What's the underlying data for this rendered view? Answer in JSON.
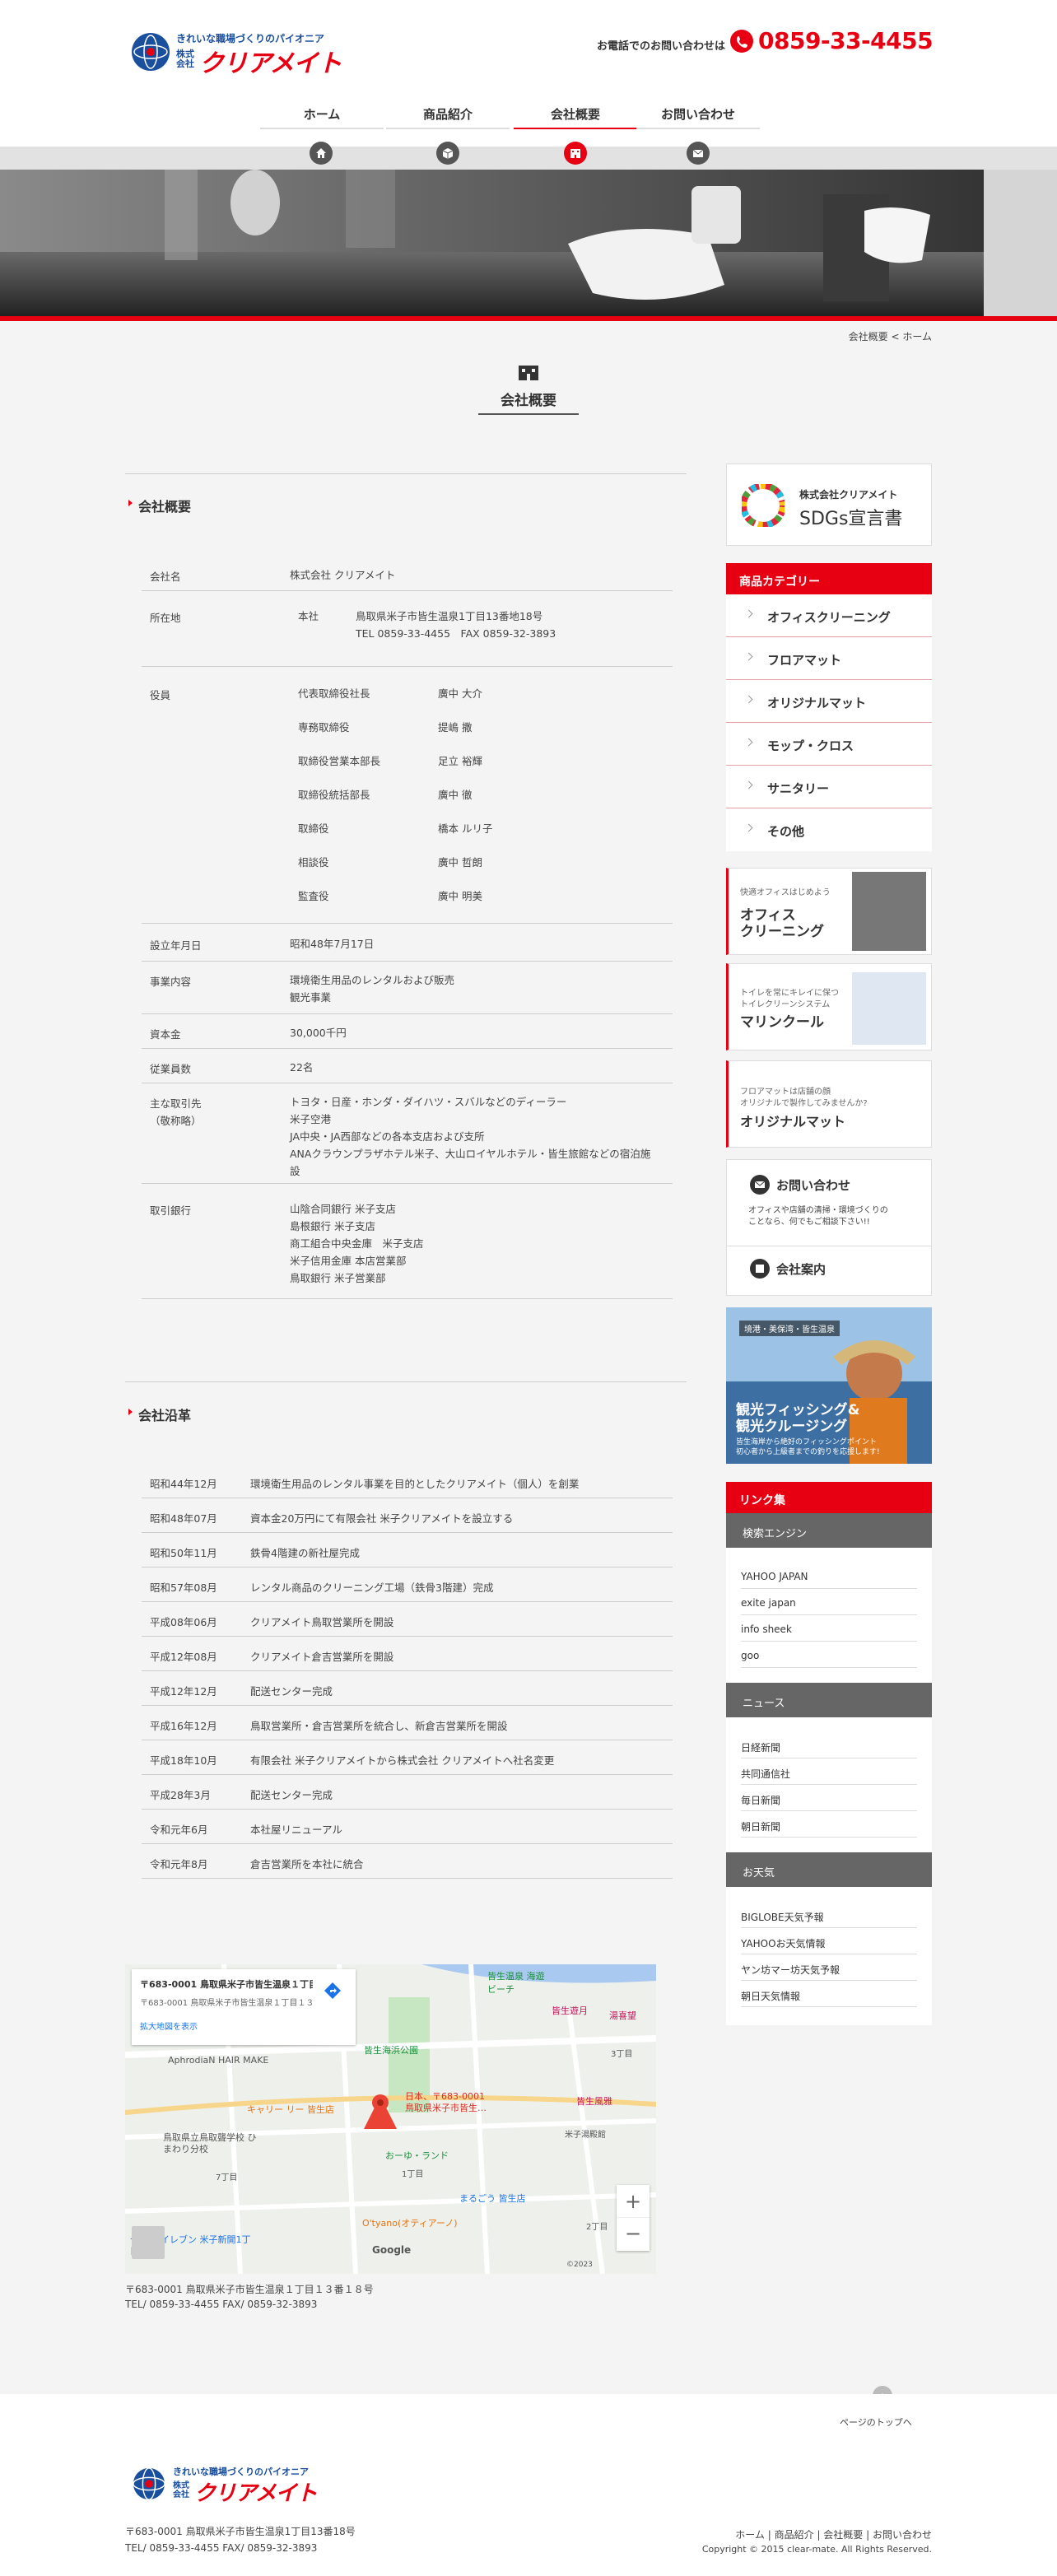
{
  "header": {
    "logo_subtitle": "きれいな職場づくりのパイオニア",
    "logo_corp": "株式会社",
    "logo_name": "クリアメイト",
    "tel_label": "お電話でのお問い合わせは",
    "tel_number": "0859-33-4455"
  },
  "nav": [
    {
      "label": "ホーム",
      "icon": "home-icon"
    },
    {
      "label": "商品紹介",
      "icon": "box-icon"
    },
    {
      "label": "会社概要",
      "icon": "building-icon",
      "active": true
    },
    {
      "label": "お問い合わせ",
      "icon": "mail-icon"
    }
  ],
  "breadcrumb": "会社概要 < ホーム",
  "page_title": "会社概要",
  "overview": {
    "title": "会社概要",
    "name_label": "会社名",
    "name_value": "株式会社 クリアメイト",
    "location_label": "所在地",
    "location_office": "本社",
    "location_address": "鳥取県米子市皆生温泉1丁目13番地18号",
    "location_tel": "TEL 0859-33-4455　FAX 0859-32-3893",
    "officers_label": "役員",
    "officers": [
      {
        "role": "代表取締役社長",
        "name": "廣中 大介"
      },
      {
        "role": "専務取締役",
        "name": "提嶋 撒"
      },
      {
        "role": "取締役営業本部長",
        "name": "足立 裕輝"
      },
      {
        "role": "取締役統括部長",
        "name": "廣中 徹"
      },
      {
        "role": "取締役",
        "name": "橋本 ルリ子"
      },
      {
        "role": "相談役",
        "name": "廣中 哲朗"
      },
      {
        "role": "監査役",
        "name": "廣中 明美"
      }
    ],
    "founded_label": "設立年月日",
    "founded_value": "昭和48年7月17日",
    "business_label": "事業内容",
    "business_value_1": "環境衛生用品のレンタルおよび販売",
    "business_value_2": "観光事業",
    "capital_label": "資本金",
    "capital_value": "30,000千円",
    "employees_label": "従業員数",
    "employees_value": "22名",
    "clients_label_1": "主な取引先",
    "clients_label_2": "（敬称略）",
    "clients_1": "トヨタ・日産・ホンダ・ダイハツ・スバルなどのディーラー",
    "clients_2": "米子空港",
    "clients_3": "JA中央・JA西部などの各本支店および支所",
    "clients_4": "ANAクラウンプラザホテル米子、大山ロイヤルホテル・皆生旅館などの宿泊施",
    "clients_5": "設",
    "banks_label": "取引銀行",
    "banks": [
      "山陰合同銀行 米子支店",
      "島根銀行 米子支店",
      "商工組合中央金庫　米子支店",
      "米子信用金庫 本店営業部",
      "鳥取銀行 米子営業部"
    ]
  },
  "history": {
    "title": "会社沿革",
    "rows": [
      {
        "date": "昭和44年12月",
        "text": "環境衛生用品のレンタル事業を目的としたクリアメイト（個人）を創業"
      },
      {
        "date": "昭和48年07月",
        "text": "資本金20万円にて有限会社 米子クリアメイトを設立する"
      },
      {
        "date": "昭和50年11月",
        "text": "鉄骨4階建の新社屋完成"
      },
      {
        "date": "昭和57年08月",
        "text": "レンタル商品のクリーニング工場（鉄骨3階建）完成"
      },
      {
        "date": "平成08年06月",
        "text": "クリアメイト鳥取営業所を開設"
      },
      {
        "date": "平成12年08月",
        "text": "クリアメイト倉吉営業所を開設"
      },
      {
        "date": "平成12年12月",
        "text": "配送センター完成"
      },
      {
        "date": "平成16年12月",
        "text": "鳥取営業所・倉吉営業所を統合し、新倉吉営業所を開設"
      },
      {
        "date": "平成18年10月",
        "text": "有限会社 米子クリアメイトから株式会社 クリアメイトへ社名変更"
      },
      {
        "date": "平成28年3月",
        "text": "配送センター完成"
      },
      {
        "date": "令和元年6月",
        "text": "本社屋リニューアル"
      },
      {
        "date": "令和元年8月",
        "text": "倉吉営業所を本社に統合"
      }
    ]
  },
  "map": {
    "popup_title": "〒683-0001 鳥取県米子市皆生温泉１丁目１３−１８",
    "popup_sub": "〒683-0001 鳥取県米子市皆生温泉１丁目１３−１８",
    "popup_link": "拡大地図を表示",
    "labels": [
      "皆生温泉 海遊ビーチ",
      "皆生遊月",
      "湯喜望",
      "皆生海浜公園",
      "AphrodiaN HAIR MAKE",
      "キャリー リー 皆生店",
      "日本、〒683-0001 鳥取県米子市皆生…",
      "皆生風雅",
      "米子湯殿館",
      "鳥取県立鳥取聾学校 ひまわり分校",
      "おーゆ・ランド",
      "まるごう 皆生店",
      "O'tyano(オティアーノ)",
      "セブン-イレブン 米子新開1丁目店",
      "7丁目",
      "1丁目",
      "2丁目",
      "3丁目",
      "Google",
      "©2023"
    ],
    "zoom_in": "+",
    "zoom_out": "−"
  },
  "address_line": "〒683-0001 鳥取県米子市皆生温泉１丁目１３番１８号",
  "contact_line": "TEL/ 0859-33-4455 FAX/ 0859-32-3893",
  "sidebar": {
    "sdgs_company": "株式会社クリアメイト",
    "sdgs_title": "SDGs宣言書",
    "category_head": "商品カテゴリー",
    "categories": [
      "オフィスクリーニング",
      "フロアマット",
      "オリジナルマット",
      "モップ・クロス",
      "サニタリー",
      "その他"
    ],
    "banner1_small": "快適オフィスはじめよう",
    "banner1_title1": "オフィス",
    "banner1_title2": "クリーニング",
    "banner2_small1": "トイレを常にキレイに保つ",
    "banner2_small2": "トイレクリーンシステム",
    "banner2_title": "マリンクール",
    "banner3_small1": "フロアマットは店舗の顔",
    "banner3_small2": "オリジナルで製作してみませんか?",
    "banner3_title": "オリジナルマット",
    "contact_title": "お問い合わせ",
    "contact_text1": "オフィスや店舗の清掃・環境づくりの",
    "contact_text2": "ことなら、何でもご相談下さい!!",
    "company_title": "会社案内",
    "fishing_tag": "境港・美保湾・皆生温泉",
    "fishing_title1": "観光フィッシング&",
    "fishing_title2": "観光クルージング",
    "fishing_text1": "皆生海岸から絶好のフィッシングポイント",
    "fishing_text2": "初心者から上級者までの釣りを応援します!",
    "links_head": "リンク集",
    "search_head": "検索エンジン",
    "search_links": [
      "YAHOO JAPAN",
      "exite japan",
      "info sheek",
      "goo"
    ],
    "news_head": "ニュース",
    "news_links": [
      "日経新聞",
      "共同通信社",
      "毎日新聞",
      "朝日新聞"
    ],
    "weather_head": "お天気",
    "weather_links": [
      "BIGLOBE天気予報",
      "YAHOOお天気情報",
      "ヤン坊マー坊天気予報",
      "朝日天気情報"
    ]
  },
  "pagetop": "ページのトップへ",
  "footer": {
    "address": "〒683-0001 鳥取県米子市皆生温泉1丁目13番18号",
    "contact": "TEL/ 0859-33-4455 FAX/ 0859-32-3893",
    "links": [
      "ホーム",
      "商品紹介",
      "会社概要",
      "お問い合わせ"
    ],
    "copyright": "Copyright © 2015 clear-mate. All Rights Reserved."
  },
  "colors": {
    "accent": "#e60012",
    "brand_blue": "#1a4f9e",
    "grey_head": "#666666"
  }
}
